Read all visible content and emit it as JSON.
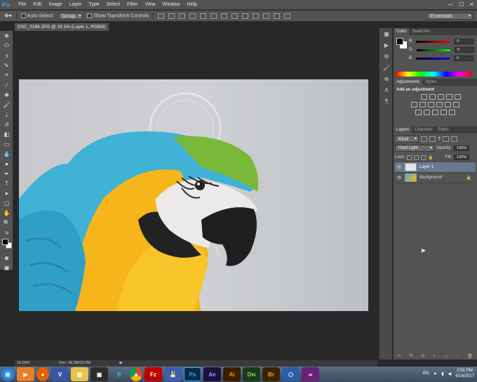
{
  "app": {
    "logo": "Ps"
  },
  "menu": [
    "File",
    "Edit",
    "Image",
    "Layer",
    "Type",
    "Select",
    "Filter",
    "View",
    "Window",
    "Help"
  ],
  "window_controls": [
    "—",
    "☐",
    "✕"
  ],
  "options": {
    "auto_select_label": "Auto-Select:",
    "auto_select_value": "Group",
    "transform_label": "Show Transform Controls",
    "workspace": "Essentials"
  },
  "document": {
    "tab_title": "DSC_0186.JPG @ 19.1% (Layer 1, RGB/8) *",
    "close": "×",
    "zoom": "19.09%",
    "doc_info": "Doc: 46.0M/33.0M"
  },
  "color_panel": {
    "tabs": [
      "Color",
      "Swatches"
    ],
    "channels": [
      {
        "label": "R",
        "value": "0",
        "color": "#e02020"
      },
      {
        "label": "G",
        "value": "0",
        "color": "#20c020"
      },
      {
        "label": "B",
        "value": "0",
        "color": "#2050e0"
      }
    ]
  },
  "adjustments_panel": {
    "tabs": [
      "Adjustments",
      "Styles"
    ],
    "heading": "Add an adjustment"
  },
  "layers_panel": {
    "tabs": [
      "Layers",
      "Channels",
      "Paths"
    ],
    "filter": "Kind",
    "blend_mode": "Hard Light",
    "opacity_label": "Opacity:",
    "opacity_value": "100%",
    "lock_label": "Lock:",
    "fill_label": "Fill:",
    "fill_value": "100%",
    "layers": [
      {
        "name": "Layer 1",
        "selected": true
      },
      {
        "name": "Background",
        "selected": false
      }
    ]
  },
  "taskbar": {
    "apps": [
      {
        "icon": "ps-icon",
        "label": "Ps",
        "color": "#0b2a4a",
        "fg": "#31a8ff"
      },
      {
        "icon": "ae-icon",
        "label": "Ae",
        "color": "#1f0f40",
        "fg": "#9999ff"
      },
      {
        "icon": "ai-icon",
        "label": "Ai",
        "color": "#3a1e00",
        "fg": "#ff9a00"
      },
      {
        "icon": "dw-icon",
        "label": "Dw",
        "color": "#1b3a1b",
        "fg": "#7cdf3a"
      },
      {
        "icon": "br-icon",
        "label": "Br",
        "color": "#3a2400",
        "fg": "#e9a23b"
      }
    ],
    "language": "EN",
    "time": "2:01 PM",
    "date": "6/14/2017"
  },
  "colors": {
    "accent": "#31a8ff",
    "panel": "#535353",
    "canvas": "#282828"
  }
}
